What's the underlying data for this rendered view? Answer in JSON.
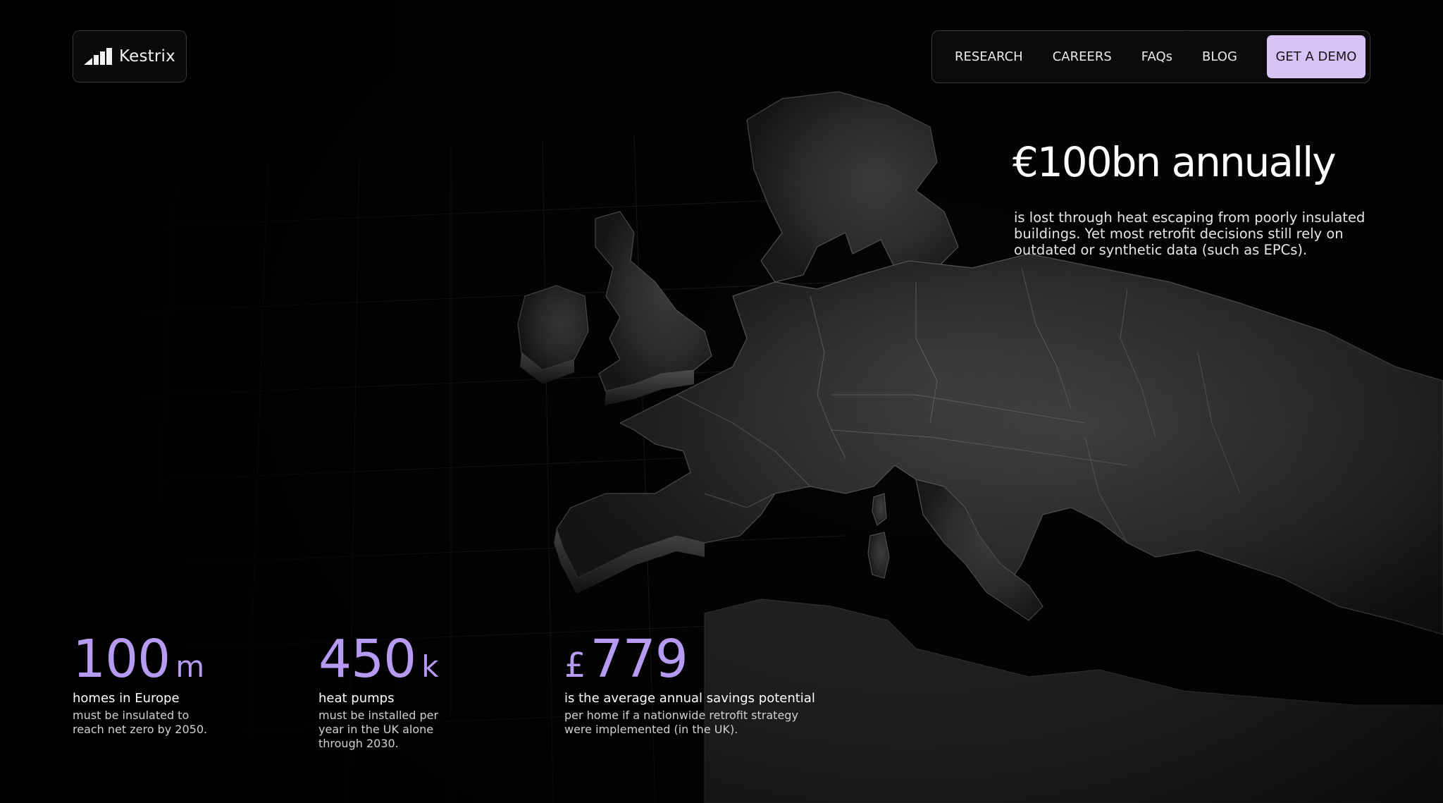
{
  "brand": {
    "name": "Kestrix"
  },
  "nav": {
    "items": [
      "RESEARCH",
      "CAREERS",
      "FAQs",
      "BLOG"
    ],
    "cta": "GET A DEMO"
  },
  "hero": {
    "headline": "€100bn annually",
    "body": "is lost through heat escaping from poorly insulated buildings. Yet most retrofit decisions still rely on outdated or synthetic data (such as EPCs)."
  },
  "stats": [
    {
      "prefix": "",
      "value": "100",
      "suffix": "m",
      "title": "homes in Europe",
      "desc": "must be insulated to reach net zero by 2050."
    },
    {
      "prefix": "",
      "value": "450",
      "suffix": "k",
      "title": "heat pumps",
      "desc": "must be installed per year in the UK alone through 2030."
    },
    {
      "prefix": "£",
      "value": "779",
      "suffix": "",
      "title": "is the average annual savings potential",
      "desc": "per home if a nationwide retrofit strategy were implemented (in the UK)."
    }
  ],
  "colors": {
    "background": "#040404",
    "accent": "#b79af1",
    "cta_background": "#d8c3f7",
    "land": "#3a3a3a",
    "border": "#3a3a3a"
  },
  "icons": {
    "logo": "bar-chart-logo-icon"
  }
}
